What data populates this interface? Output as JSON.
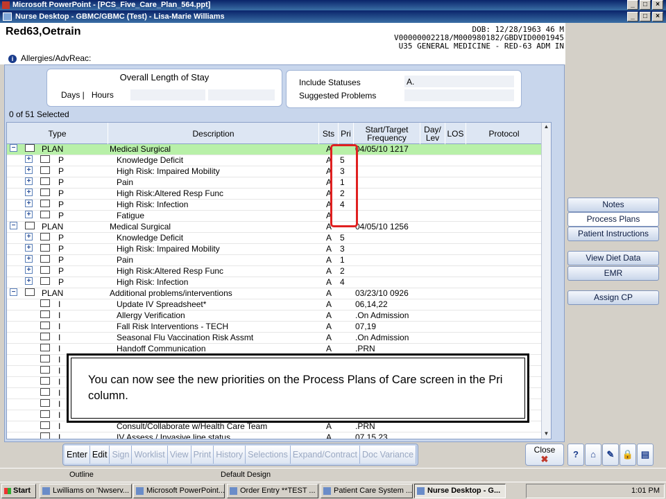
{
  "pp_title": "Microsoft PowerPoint - [PCS_Five_Care_Plan_564.ppt]",
  "window_title": "Nurse Desktop - GBMC/GBMC (Test) - Lisa-Marie Williams",
  "patient": {
    "name": "Red63,Oetrain",
    "dob_line": "DOB: 12/28/1963 46 M",
    "id_line": "V00000002218/M000980182/GBDVID0001945",
    "unit_line": "U35 GENERAL MEDICINE - RED-63 ADM IN",
    "allergies": "Allergies/AdvReac:"
  },
  "stay": {
    "title": "Overall Length of Stay",
    "days": "Days |",
    "hours": "Hours"
  },
  "include": {
    "statuses_label": "Include Statuses",
    "statuses_value": "A.",
    "suggested_label": "Suggested Problems"
  },
  "selected_count": "0 of 51 Selected",
  "columns": [
    "Type",
    "Description",
    "Sts",
    "Pri",
    "Start/Target Frequency",
    "Day/ Lev",
    "LOS",
    "Protocol"
  ],
  "rows": [
    {
      "exp": "−",
      "cb": true,
      "type": "PLAN",
      "desc": "Medical Surgical",
      "indent": 0,
      "sts": "A",
      "pri": "",
      "freq": "04/05/10 1217",
      "hl": true
    },
    {
      "exp": "+",
      "cb": true,
      "type": "P",
      "desc": "Knowledge Deficit",
      "indent": 1,
      "sts": "A",
      "pri": "5",
      "freq": ""
    },
    {
      "exp": "+",
      "cb": true,
      "type": "P",
      "desc": "High Risk: Impaired Mobility",
      "indent": 1,
      "sts": "A",
      "pri": "3",
      "freq": ""
    },
    {
      "exp": "+",
      "cb": true,
      "type": "P",
      "desc": "Pain",
      "indent": 1,
      "sts": "A",
      "pri": "1",
      "freq": ""
    },
    {
      "exp": "+",
      "cb": true,
      "type": "P",
      "desc": "High Risk:Altered Resp Func",
      "indent": 1,
      "sts": "A",
      "pri": "2",
      "freq": ""
    },
    {
      "exp": "+",
      "cb": true,
      "type": "P",
      "desc": "High Risk: Infection",
      "indent": 1,
      "sts": "A",
      "pri": "4",
      "freq": ""
    },
    {
      "exp": "+",
      "cb": true,
      "type": "P",
      "desc": "Fatigue",
      "indent": 1,
      "sts": "A",
      "pri": "",
      "freq": ""
    },
    {
      "exp": "−",
      "cb": true,
      "type": "PLAN",
      "desc": "Medical Surgical",
      "indent": 0,
      "sts": "A",
      "pri": "",
      "freq": "04/05/10 1256"
    },
    {
      "exp": "+",
      "cb": true,
      "type": "P",
      "desc": "Knowledge Deficit",
      "indent": 1,
      "sts": "A",
      "pri": "5",
      "freq": ""
    },
    {
      "exp": "+",
      "cb": true,
      "type": "P",
      "desc": "High Risk: Impaired Mobility",
      "indent": 1,
      "sts": "A",
      "pri": "3",
      "freq": ""
    },
    {
      "exp": "+",
      "cb": true,
      "type": "P",
      "desc": "Pain",
      "indent": 1,
      "sts": "A",
      "pri": "1",
      "freq": ""
    },
    {
      "exp": "+",
      "cb": true,
      "type": "P",
      "desc": "High Risk:Altered Resp Func",
      "indent": 1,
      "sts": "A",
      "pri": "2",
      "freq": ""
    },
    {
      "exp": "+",
      "cb": true,
      "type": "P",
      "desc": "High Risk: Infection",
      "indent": 1,
      "sts": "A",
      "pri": "4",
      "freq": ""
    },
    {
      "exp": "−",
      "cb": true,
      "type": "PLAN",
      "desc": "Additional problems/interventions",
      "indent": 0,
      "sts": "A",
      "pri": "",
      "freq": "03/23/10 0926"
    },
    {
      "exp": "",
      "cb": true,
      "type": "I",
      "desc": "Update IV Spreadsheet*",
      "indent": 1,
      "sts": "A",
      "pri": "",
      "freq": "06,14,22"
    },
    {
      "exp": "",
      "cb": true,
      "type": "I",
      "desc": "Allergy Verification",
      "indent": 1,
      "sts": "A",
      "pri": "",
      "freq": ".On Admission"
    },
    {
      "exp": "",
      "cb": true,
      "type": "I",
      "desc": "Fall Risk Interventions - TECH",
      "indent": 1,
      "sts": "A",
      "pri": "",
      "freq": "07,19"
    },
    {
      "exp": "",
      "cb": true,
      "type": "I",
      "desc": "Seasonal Flu Vaccination Risk Assmt",
      "indent": 1,
      "sts": "A",
      "pri": "",
      "freq": ".On Admission"
    },
    {
      "exp": "",
      "cb": true,
      "type": "I",
      "desc": "Handoff Communication",
      "indent": 1,
      "sts": "A",
      "pri": "",
      "freq": ".PRN"
    },
    {
      "exp": "",
      "cb": true,
      "type": "I",
      "desc": "",
      "indent": 1,
      "sts": "",
      "pri": "",
      "freq": ""
    },
    {
      "exp": "",
      "cb": true,
      "type": "I",
      "desc": "",
      "indent": 1,
      "sts": "",
      "pri": "",
      "freq": ""
    },
    {
      "exp": "",
      "cb": true,
      "type": "I",
      "desc": "",
      "indent": 1,
      "sts": "",
      "pri": "",
      "freq": ""
    },
    {
      "exp": "",
      "cb": true,
      "type": "I",
      "desc": "",
      "indent": 1,
      "sts": "",
      "pri": "",
      "freq": ""
    },
    {
      "exp": "",
      "cb": true,
      "type": "I",
      "desc": "",
      "indent": 1,
      "sts": "",
      "pri": "",
      "freq": ""
    },
    {
      "exp": "",
      "cb": true,
      "type": "I",
      "desc": "",
      "indent": 1,
      "sts": "",
      "pri": "",
      "freq": ""
    },
    {
      "exp": "",
      "cb": true,
      "type": "I",
      "desc": "Consult/Collaborate w/Health Care Team",
      "indent": 1,
      "sts": "A",
      "pri": "",
      "freq": ".PRN"
    },
    {
      "exp": "",
      "cb": true,
      "type": "I",
      "desc": "IV Assess / Invasive line status",
      "indent": 1,
      "sts": "A",
      "pri": "",
      "freq": "07,15,23"
    }
  ],
  "side_buttons": [
    "Notes",
    "Process Plans",
    "Patient Instructions",
    "View Diet Data",
    "EMR",
    "Assign CP"
  ],
  "toolbar": [
    {
      "label": "Enter",
      "enabled": true
    },
    {
      "label": "Edit",
      "enabled": true
    },
    {
      "label": "Sign",
      "enabled": false
    },
    {
      "label": "Worklist",
      "enabled": false
    },
    {
      "label": "View",
      "enabled": false
    },
    {
      "label": "Print",
      "enabled": false
    },
    {
      "label": "History",
      "enabled": false
    },
    {
      "label": "Selections",
      "enabled": false
    },
    {
      "label": "Expand/Contract",
      "enabled": false
    },
    {
      "label": "Doc Variance",
      "enabled": false
    }
  ],
  "close_label": "Close",
  "icon_buttons": [
    "?",
    "⌂",
    "✎",
    "🔒",
    "▤"
  ],
  "ppt_status": {
    "outline": "Outline",
    "design": "Default Design"
  },
  "taskbar": {
    "start": "Start",
    "items": [
      "Lwilliams on 'Nwserv...",
      "Microsoft PowerPoint...",
      "Order Entry **TEST ...",
      "Patient Care System ...",
      "Nurse Desktop - G..."
    ],
    "clock": "1:01 PM"
  },
  "callout": "You can now see the new priorities on the Process Plans of Care screen in the Pri column.",
  "colors": {
    "highlight_row": "#b8f0a8",
    "annotation_box": "#e02020",
    "panel_bg": "#c8d6ec"
  }
}
